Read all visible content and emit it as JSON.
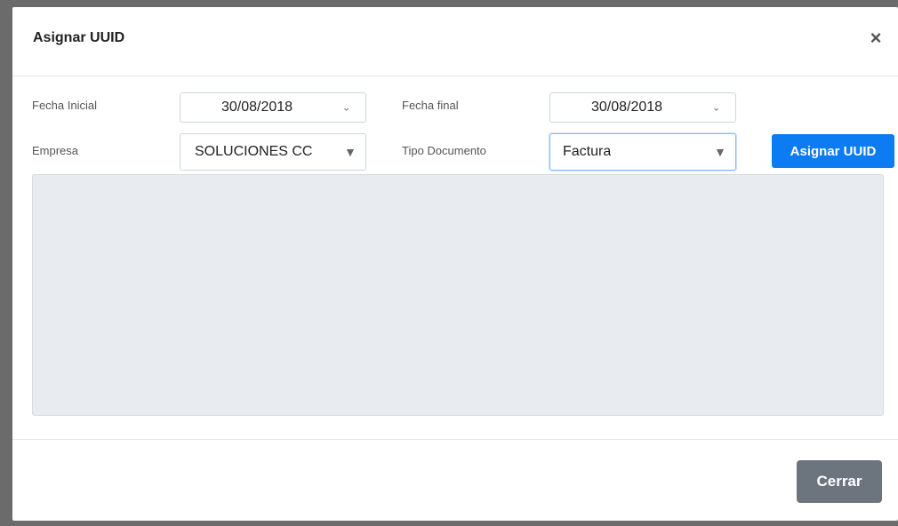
{
  "modal": {
    "title": "Asignar UUID",
    "close_symbol": "×"
  },
  "form": {
    "fecha_inicial": {
      "label": "Fecha Inicial",
      "value": "30/08/2018",
      "icon": "chevron-down-icon"
    },
    "fecha_final": {
      "label": "Fecha final",
      "value": "30/08/2018",
      "icon": "chevron-down-icon"
    },
    "empresa": {
      "label": "Empresa",
      "value": "SOLUCIONES CC",
      "icon": "triangle-down-icon"
    },
    "tipo_documento": {
      "label": "Tipo Documento",
      "value": "Factura",
      "icon": "triangle-down-icon"
    }
  },
  "buttons": {
    "asignar_label": "Asignar UUID",
    "cerrar_label": "Cerrar"
  },
  "colors": {
    "primary": "#0d7bf2",
    "secondary": "#6c757d",
    "results_bg": "#e8ebef"
  }
}
